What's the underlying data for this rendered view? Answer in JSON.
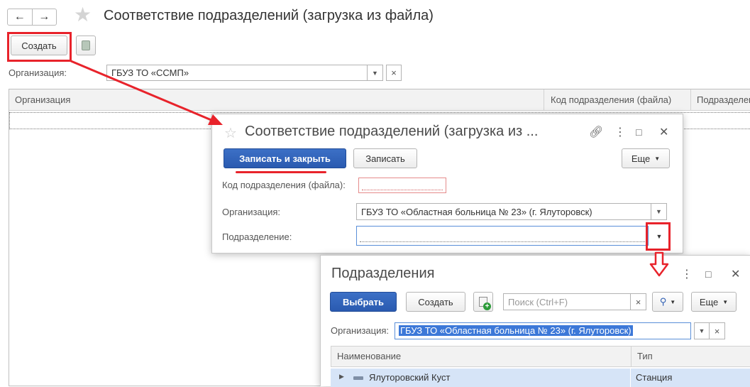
{
  "main": {
    "title": "Соответствие подразделений (загрузка из файла)",
    "nav": {
      "back_icon": "arrow-left",
      "forward_icon": "arrow-right",
      "favorite_icon": "star"
    },
    "toolbar": {
      "create_label": "Создать"
    },
    "filter": {
      "label": "Организация:",
      "value": "ГБУЗ ТО «ССМП»"
    },
    "table": {
      "columns": [
        "Организация",
        "Код подразделения (файла)",
        "Подразделение"
      ]
    }
  },
  "dialog1": {
    "title": "Соответствие подразделений (загрузка из ...",
    "save_close_label": "Записать и закрыть",
    "save_label": "Записать",
    "more_label": "Еще",
    "fields": {
      "code_label": "Код подразделения (файла):",
      "code_value": "",
      "org_label": "Организация:",
      "org_value": "ГБУЗ ТО «Областная больница № 23» (г. Ялуторовск)",
      "subdivision_label": "Подразделение:",
      "subdivision_value": ""
    }
  },
  "dialog2": {
    "title": "Подразделения",
    "choose_label": "Выбрать",
    "create_label": "Создать",
    "search_placeholder": "Поиск (Ctrl+F)",
    "more_label": "Еще",
    "org_label": "Организация:",
    "org_value": "ГБУЗ ТО «Областная больница № 23» (г. Ялуторовск)",
    "columns": [
      "Наименование",
      "Тип"
    ],
    "rows": [
      {
        "name": "Ялуторовский Куст",
        "type": "Станция"
      }
    ]
  },
  "annotation_color": "#e8232b",
  "accent_color": "#2f5fb3"
}
